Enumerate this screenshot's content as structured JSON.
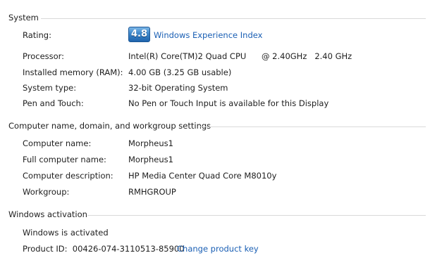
{
  "system": {
    "title": "System",
    "rating_label": "Rating:",
    "rating_score": "4.8",
    "rating_link": "Windows Experience Index",
    "rows": [
      {
        "label": "Processor:",
        "value": "Intel(R) Core(TM)2 Quad CPU",
        "value2": "@ 2.40GHz   2.40 GHz"
      },
      {
        "label": "Installed memory (RAM):",
        "value": "4.00 GB (3.25 GB usable)"
      },
      {
        "label": "System type:",
        "value": "32-bit Operating System"
      },
      {
        "label": "Pen and Touch:",
        "value": "No Pen or Touch Input is available for this Display"
      }
    ]
  },
  "computer": {
    "title": "Computer name, domain, and workgroup settings",
    "rows": [
      {
        "label": "Computer name:",
        "value": "Morpheus1"
      },
      {
        "label": "Full computer name:",
        "value": "Morpheus1"
      },
      {
        "label": "Computer description:",
        "value": "HP Media Center Quad Core M8010y"
      },
      {
        "label": "Workgroup:",
        "value": "RMHGROUP"
      }
    ]
  },
  "activation": {
    "title": "Windows activation",
    "status": "Windows is activated",
    "product_id": "Product ID:  00426-074-3110513-85900",
    "change_key": "Change product key"
  },
  "colors": {
    "link": "#1a5fb4",
    "rule": "#d9d9d9"
  }
}
